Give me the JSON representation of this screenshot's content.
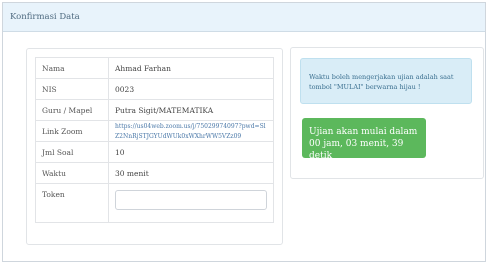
{
  "header": {
    "title": "Konfirmasi Data"
  },
  "info": {
    "rows": [
      {
        "label": "Nama",
        "value": "Ahmad Farhan"
      },
      {
        "label": "NIS",
        "value": "0023"
      },
      {
        "label": "Guru / Mapel",
        "value": "Putra Sigit/MATEMATIKA"
      },
      {
        "label": "Link Zoom",
        "value": "https://us04web.zoom.us/j/75029974097?pwd=SlZ2NnRjSTJGYUdWUk0xWXhrWW5VZz09"
      },
      {
        "label": "Jml Soal",
        "value": "10"
      },
      {
        "label": "Waktu",
        "value": "30 menit"
      },
      {
        "label": "Token",
        "value": ""
      }
    ]
  },
  "notice": {
    "text": "Waktu boleh mengerjakan ujian adalah saat tombol \"MULAI\" berwarna hijau !"
  },
  "countdown": {
    "line1": "Ujian akan mulai dalam",
    "line2": "00 jam, 03 menit, 39 detik"
  },
  "colors": {
    "header_bg": "#e8f3fb",
    "info_bg": "#d9edf7",
    "success": "#5cb85c"
  }
}
